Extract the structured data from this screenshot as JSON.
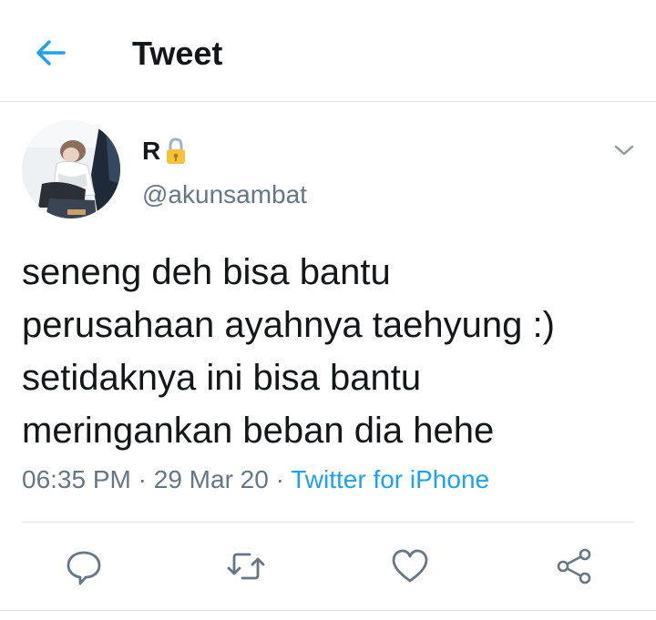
{
  "header": {
    "title": "Tweet",
    "back_icon": "arrow-left-icon"
  },
  "colors": {
    "accent": "#1da1f2",
    "text_primary": "#14171a",
    "text_secondary": "#657786",
    "divider": "#dfe3e6"
  },
  "tweet": {
    "author": {
      "display_name": "R",
      "handle": "@akunsambat",
      "badge_icon": "lock-icon"
    },
    "text_lines": [
      "seneng deh bisa bantu",
      "perusahaan ayahnya taehyung :)",
      "setidaknya ini bisa bantu",
      "meringankan beban dia hehe"
    ],
    "time": "06:35 PM",
    "date": "29 Mar 20",
    "separator": "·",
    "source": "Twitter for iPhone"
  },
  "actions": [
    {
      "icon": "reply-icon"
    },
    {
      "icon": "retweet-icon"
    },
    {
      "icon": "like-icon"
    },
    {
      "icon": "share-icon"
    }
  ]
}
